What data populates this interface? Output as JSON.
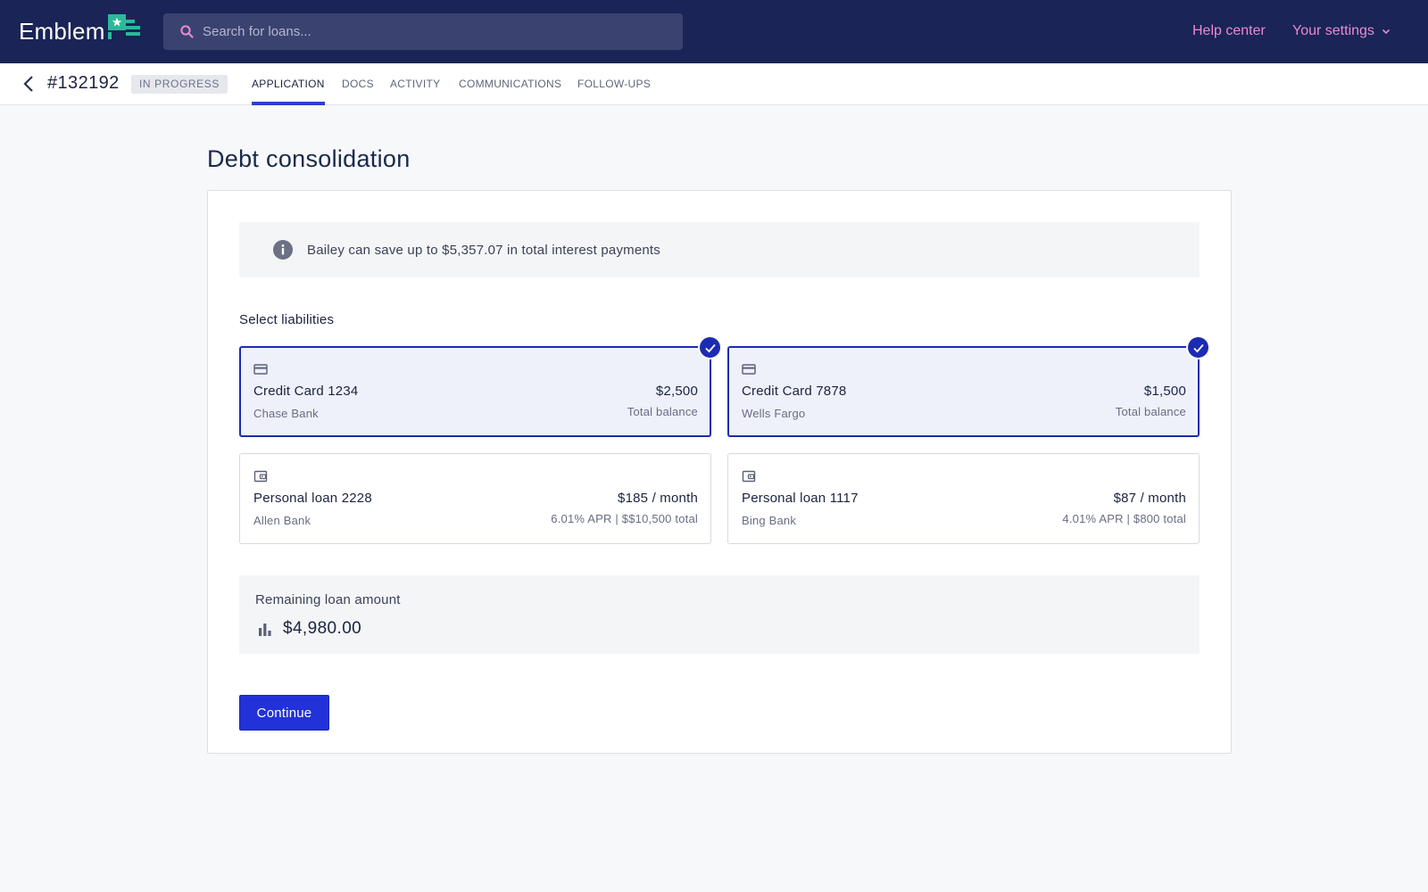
{
  "topbar": {
    "brand": "Emblem",
    "search_placeholder": "Search for loans...",
    "help_label": "Help center",
    "settings_label": "Your settings",
    "background": "#1a2456",
    "link_color": "#e88bd0"
  },
  "subnav": {
    "loan_id": "#132192",
    "status": "IN PROGRESS",
    "tabs": [
      {
        "label": "APPLICATION",
        "active": true
      },
      {
        "label": "DOCS"
      },
      {
        "label": "ACTIVITY"
      },
      {
        "label": "COMMUNICATIONS"
      },
      {
        "label": "FOLLOW-UPS"
      }
    ]
  },
  "page": {
    "title": "Debt consolidation",
    "info_text": "Bailey can save up to $5,357.07 in total interest payments",
    "section_label": "Select liabilities",
    "liabilities": [
      {
        "name": "Credit Card 1234",
        "bank": "Chase Bank",
        "amount": "$2,500",
        "sub": "Total balance",
        "icon": "credit-card-icon",
        "selected": true
      },
      {
        "name": "Credit Card 7878",
        "bank": "Wells Fargo",
        "amount": "$1,500",
        "sub": "Total balance",
        "icon": "credit-card-icon",
        "selected": true
      },
      {
        "name": "Personal loan 2228",
        "bank": "Allen Bank",
        "amount": "$185 / month",
        "sub": "6.01% APR | $$10,500 total",
        "icon": "wallet-icon",
        "selected": false
      },
      {
        "name": "Personal loan 1117",
        "bank": "Bing Bank",
        "amount": "$87 / month",
        "sub": "4.01% APR | $800 total",
        "icon": "wallet-icon",
        "selected": false
      }
    ],
    "remaining_label": "Remaining loan amount",
    "remaining_value": "$4,980.00",
    "continue_label": "Continue",
    "accent": "#2232d8"
  }
}
